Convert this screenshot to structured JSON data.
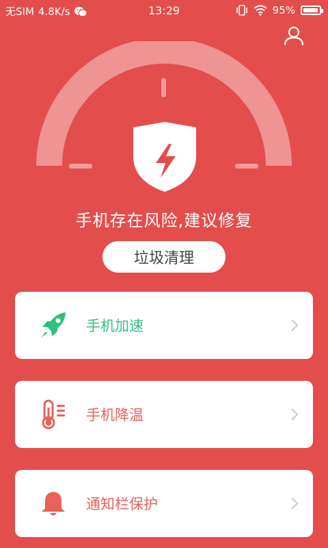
{
  "status_bar": {
    "carrier": "无SIM",
    "speed": "4.8K/s",
    "time": "13:29",
    "battery": "95%",
    "battery_level": 0.95
  },
  "header": {
    "profile_icon": "user-icon"
  },
  "gauge": {
    "icon": "shield-lightning-icon"
  },
  "status": {
    "message": "手机存在风险,建议修复"
  },
  "clean_button": {
    "label": "垃圾清理"
  },
  "cards": [
    {
      "label": "手机加速",
      "icon": "rocket-icon",
      "color": "#2EC27E"
    },
    {
      "label": "手机降温",
      "icon": "thermometer-icon",
      "color": "#E8615A"
    },
    {
      "label": "通知栏保护",
      "icon": "bell-icon",
      "color": "#E8615A"
    }
  ],
  "colors": {
    "background": "#E34D4C",
    "card": "#FFFFFF",
    "accent_green": "#2EC27E",
    "accent_red": "#E8615A"
  }
}
